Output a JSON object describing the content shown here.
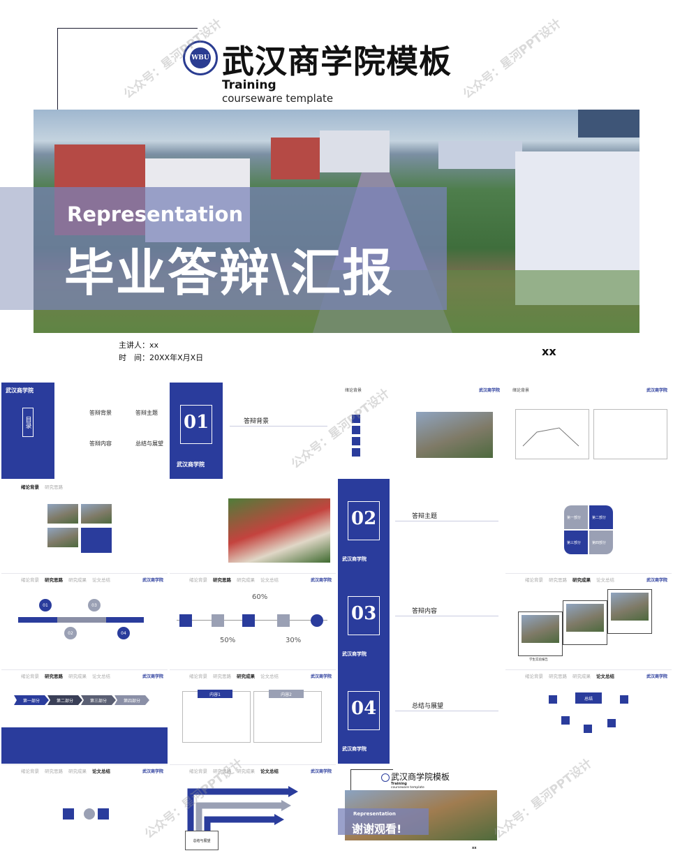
{
  "hero": {
    "title": "武汉商学院模板",
    "training": "Training",
    "courseware": "courseware template",
    "representation": "Representation",
    "main_title": "毕业答辩\\汇报",
    "presenter": "主讲人：xx",
    "date": "时　间：20XX年X月X日",
    "xx": "xx",
    "logo_text": "WBU"
  },
  "watermark": "公众号：星河PPT设计",
  "school_name": "武汉商学院",
  "nav": [
    "绪论背景",
    "研究思路",
    "研究成果",
    "论文总结"
  ],
  "toc": {
    "title": "目录",
    "items": [
      "答辩背景",
      "答辩主题",
      "答辩内容",
      "总结与展望"
    ]
  },
  "sections": [
    {
      "num": "01",
      "title": "答辩背景"
    },
    {
      "num": "02",
      "title": "答辩主题"
    },
    {
      "num": "03",
      "title": "答辩内容"
    },
    {
      "num": "04",
      "title": "总结与展望"
    }
  ],
  "placeholder": "输入您的内容输入您的内容",
  "percent": [
    "60%",
    "50%",
    "30%"
  ],
  "quadrant": [
    "第一部分",
    "第二部分",
    "第三部分",
    "第四部分"
  ],
  "steps": [
    "第一部分",
    "第二部分",
    "第三部分",
    "第四部分"
  ],
  "content_tabs": [
    "内容1",
    "内容2"
  ],
  "timeline_nums": [
    "01",
    "02",
    "03",
    "04"
  ],
  "hub_label": "总结",
  "summary_box": "总结与展望",
  "caption": "学生实验报告",
  "thanks": {
    "title": "武汉商学院模板",
    "training": "Training",
    "cw": "courseware template",
    "rep": "Representation",
    "big": "谢谢观看!",
    "xx": "xx"
  }
}
